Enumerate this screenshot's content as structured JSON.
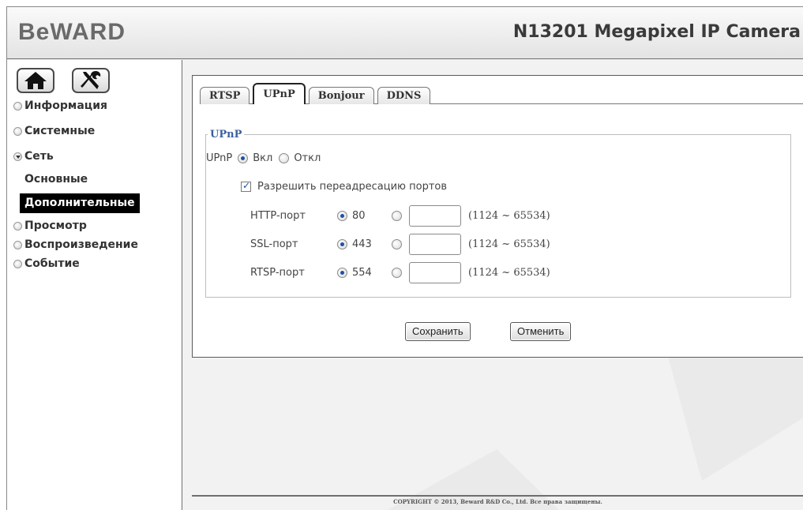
{
  "header": {
    "logo_text": "BeWARD",
    "title": "N13201 Megapixel IP Camera"
  },
  "sidebar": {
    "home_icon": "home-icon",
    "tools_icon": "tools-icon",
    "menu": [
      {
        "label": "Информация"
      },
      {
        "label": "Системные"
      },
      {
        "label": "Сеть",
        "expanded": true
      },
      {
        "label": "Просмотр"
      },
      {
        "label": "Воспроизведение"
      },
      {
        "label": "Событие"
      }
    ],
    "network_sub": [
      {
        "label": "Основные"
      },
      {
        "label": "Дополнительные",
        "active": true
      }
    ]
  },
  "tabs": [
    {
      "label": "RTSP"
    },
    {
      "label": "UPnP",
      "active": true
    },
    {
      "label": "Bonjour"
    },
    {
      "label": "DDNS"
    }
  ],
  "upnp": {
    "legend": "UPnP",
    "enable_label": "UPnP",
    "on_label": "Вкл",
    "off_label": "Откл",
    "enabled": true,
    "port_forward_label": "Разрешить переадресацию портов",
    "port_forward_checked": true,
    "ports": [
      {
        "label": "HTTP-порт",
        "default": "80",
        "custom_value": "",
        "range": "(1124 ~ 65534)"
      },
      {
        "label": "SSL-порт",
        "default": "443",
        "custom_value": "",
        "range": "(1124 ~ 65534)"
      },
      {
        "label": "RTSP-порт",
        "default": "554",
        "custom_value": "",
        "range": "(1124 ~ 65534)"
      }
    ]
  },
  "buttons": {
    "save": "Сохранить",
    "cancel": "Отменить"
  },
  "footer": {
    "copyright": "COPYRIGHT © 2013, Beward R&D Co., Ltd. Все права защищены."
  },
  "colors": {
    "accent": "#3a5fa0",
    "radio_dot": "#1e4fa8",
    "active_menu_bg": "#000000"
  }
}
